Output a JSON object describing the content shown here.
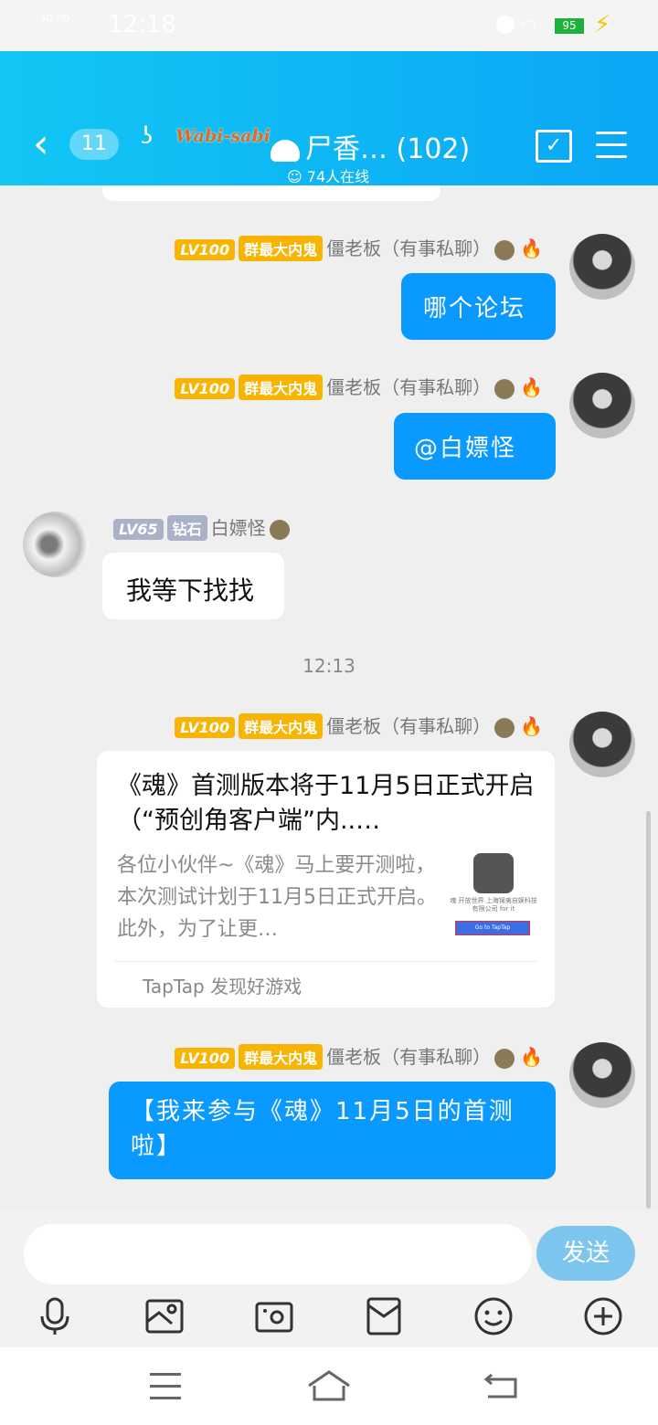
{
  "status": {
    "time": "12:18",
    "network": "4G HD",
    "battery": "95"
  },
  "header": {
    "unread_count": "11",
    "group_tag": "Wabi-sabi",
    "title": "尸香… (102)",
    "online": "74人在线"
  },
  "messages": [
    {
      "level": "LV100",
      "title": "群最大内鬼",
      "sender": "僵老板（有事私聊）",
      "text": "哪个论坛"
    },
    {
      "level": "LV100",
      "title": "群最大内鬼",
      "sender": "僵老板（有事私聊）",
      "text": "@白嫖怪"
    },
    {
      "level": "LV65",
      "title": "钻石",
      "sender": "白嫖怪",
      "text": "我等下找找"
    },
    {
      "level": "LV100",
      "title": "群最大内鬼",
      "sender": "僵老板（有事私聊）"
    },
    {
      "level": "LV100",
      "title": "群最大内鬼",
      "sender": "僵老板（有事私聊）",
      "text": "【我来参与《魂》11月5日的首测啦】"
    }
  ],
  "timestamp": "12:13",
  "share_card": {
    "title": "《魂》首测版本将于11月5日正式开启（“预创角客户端”内..…",
    "description": "各位小伙伴~《魂》马上要开测啦，本次测试计划于11月5日正式开启。此外，为了让更…",
    "thumb_text": "魂 开放世界 上海锦夷自娱科技有限公司 for it",
    "thumb_button": "Go to TapTap",
    "source": "TapTap 发现好游戏"
  },
  "input": {
    "placeholder": "",
    "send_label": "发送"
  },
  "icons": {
    "toolbar": [
      "microphone-icon",
      "image-icon",
      "camera-icon",
      "red-packet-icon",
      "emoji-icon",
      "plus-icon"
    ],
    "nav": [
      "menu-icon",
      "home-icon",
      "back-icon"
    ]
  },
  "colors": {
    "header": "#0aa7f5",
    "bubble": "#0a99ff",
    "send": "#7cc5ef",
    "level": "#f8b400"
  }
}
